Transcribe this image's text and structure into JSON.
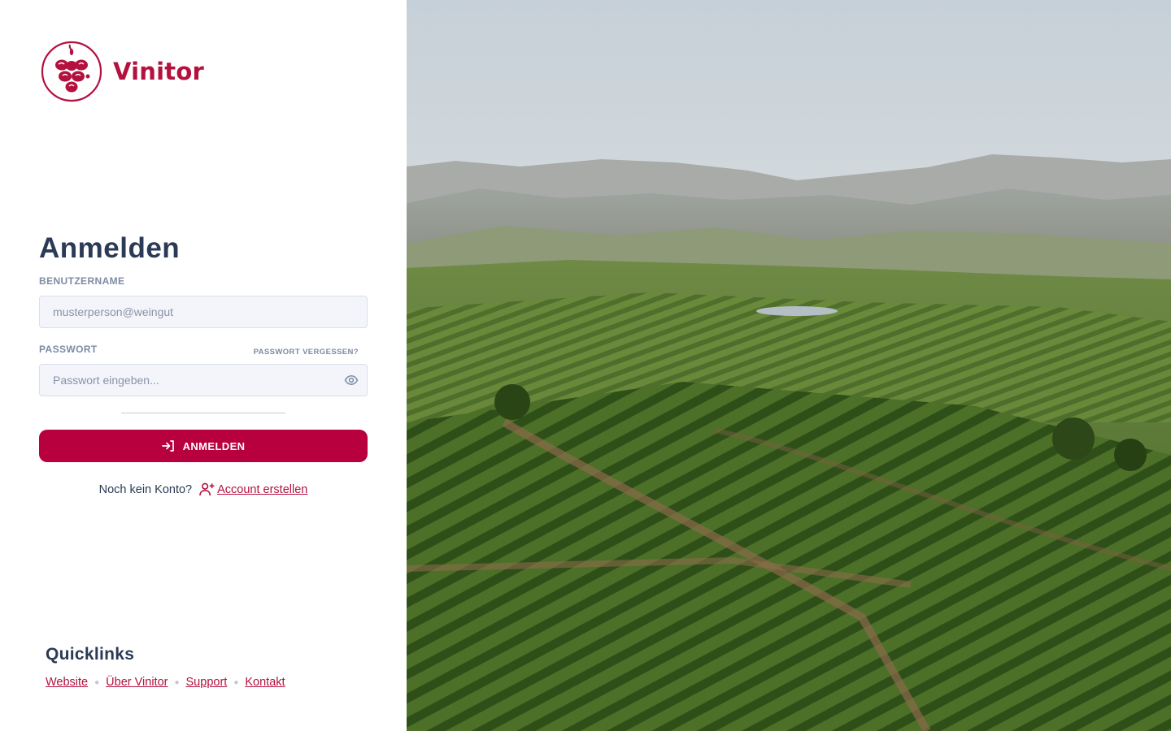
{
  "brand": {
    "name": "Vinitor",
    "color": "#b3123f"
  },
  "login": {
    "title": "Anmelden",
    "username_label": "BENUTZERNAME",
    "username_placeholder": "musterperson@weingut",
    "password_label": "PASSWORT",
    "forgot_password": "PASSWORT VERGESSEN?",
    "password_placeholder": "Passwort eingeben...",
    "submit_label": "ANMELDEN",
    "no_account_text": "Noch kein Konto?",
    "create_account_label": "Account erstellen"
  },
  "quicklinks": {
    "title": "Quicklinks",
    "items": [
      {
        "label": "Website"
      },
      {
        "label": "Über Vinitor"
      },
      {
        "label": "Support"
      },
      {
        "label": "Kontakt"
      }
    ]
  },
  "icons": {
    "logo": "grape-logo-icon",
    "password_toggle": "eye-icon",
    "submit": "login-arrow-icon",
    "signup": "user-plus-icon"
  },
  "colors": {
    "accent": "#b8003f",
    "text": "#2b3a55",
    "muted": "#7d8ba3",
    "input_bg": "#f4f5fb"
  }
}
